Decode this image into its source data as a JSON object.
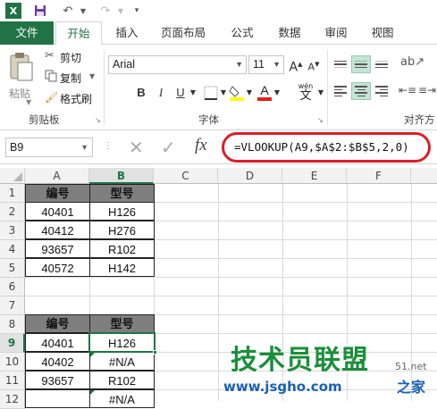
{
  "ribbon_tabs": [
    "文件",
    "开始",
    "插入",
    "页面布局",
    "公式",
    "数据",
    "审阅",
    "视图"
  ],
  "clipboard": {
    "paste": "粘贴",
    "cut": "剪切",
    "copy": "复制",
    "format_painter": "格式刷",
    "group": "剪贴板"
  },
  "font": {
    "name": "Arial",
    "size": "11",
    "bold": "B",
    "italic": "I",
    "underline": "U",
    "wen": "wén",
    "wen_char": "文",
    "group": "字体"
  },
  "alignment": {
    "group": "对齐方"
  },
  "formula_bar": {
    "name_box": "B9",
    "formula": "=VLOOKUP(A9,$A$2:$B$5,2,0)",
    "cancel": "✕",
    "enter": "✓",
    "fx": "fx"
  },
  "columns": [
    "A",
    "B",
    "C",
    "D",
    "E",
    "F"
  ],
  "rows": [
    "1",
    "2",
    "3",
    "4",
    "5",
    "6",
    "7",
    "8",
    "9",
    "10",
    "11",
    "12"
  ],
  "table1": {
    "headers": [
      "编号",
      "型号"
    ],
    "data": [
      [
        "40401",
        "H126"
      ],
      [
        "40412",
        "H276"
      ],
      [
        "93657",
        "R102"
      ],
      [
        "40572",
        "H142"
      ]
    ]
  },
  "table2": {
    "headers": [
      "编号",
      "型号"
    ],
    "data": [
      [
        "40401",
        "H126"
      ],
      [
        "40402",
        "#N/A"
      ],
      [
        "93657",
        "R102"
      ],
      [
        "",
        "#N/A"
      ]
    ]
  },
  "watermark": {
    "main": "技术员联盟",
    "url": "www.jsgho.com",
    "side": "51.net",
    "side2": "之家"
  },
  "colors": {
    "excel_green": "#217346",
    "highlight": "#c5e4d3",
    "oval": "#d8202a"
  }
}
